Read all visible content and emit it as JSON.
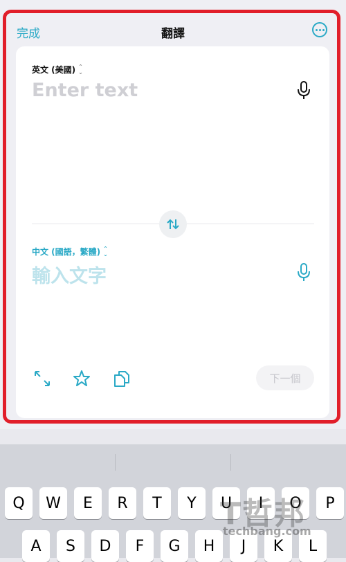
{
  "header": {
    "done_label": "完成",
    "title": "翻譯",
    "more_icon": "ellipsis-circle-icon"
  },
  "source": {
    "language": "英文 (美國)",
    "placeholder": "Enter text",
    "mic_icon": "microphone-icon"
  },
  "target": {
    "language": "中文 (國語，繁體)",
    "placeholder": "輸入文字",
    "mic_icon": "microphone-icon"
  },
  "swap_icon": "swap-arrows-icon",
  "toolbar": {
    "expand_icon": "expand-icon",
    "favorite_icon": "star-icon",
    "copy_icon": "copy-icon",
    "next_label": "下一個"
  },
  "keyboard": {
    "row1": [
      "Q",
      "W",
      "E",
      "R",
      "T",
      "Y",
      "U",
      "I",
      "O",
      "P"
    ],
    "row2": [
      "A",
      "S",
      "D",
      "F",
      "G",
      "H",
      "J",
      "K",
      "L"
    ]
  },
  "watermark": {
    "text": "T哲邦",
    "site": "techbang.com"
  },
  "colors": {
    "accent": "#2aa9c6",
    "highlight_frame": "#e11e2a"
  }
}
